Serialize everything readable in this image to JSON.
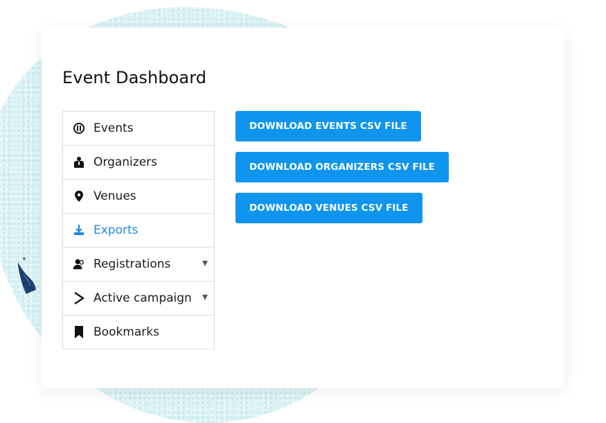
{
  "dashboard": {
    "title": "Event Dashboard"
  },
  "menu": {
    "items": [
      {
        "label": "Events",
        "icon": "events-icon",
        "active": false
      },
      {
        "label": "Organizers",
        "icon": "organizer-icon",
        "active": false
      },
      {
        "label": "Venues",
        "icon": "location-pin-icon",
        "active": false
      },
      {
        "label": "Exports",
        "icon": "download-icon",
        "active": true
      },
      {
        "label": "Registrations",
        "icon": "users-icon",
        "active": false,
        "has_submenu": true
      },
      {
        "label": "Active campaign",
        "icon": "chevron-right-icon",
        "active": false,
        "has_submenu": true
      },
      {
        "label": "Bookmarks",
        "icon": "bookmark-icon",
        "active": false
      }
    ]
  },
  "exports": {
    "buttons": [
      {
        "label": "DOWNLOAD EVENTS CSV FILE"
      },
      {
        "label": "DOWNLOAD ORGANIZERS CSV FILE"
      },
      {
        "label": "DOWNLOAD VENUES CSV FILE"
      }
    ]
  },
  "colors": {
    "accent": "#0f95ee",
    "active_text": "#1e88e5",
    "border": "#dcdcdc",
    "background_blob": "#ddf3f5"
  }
}
